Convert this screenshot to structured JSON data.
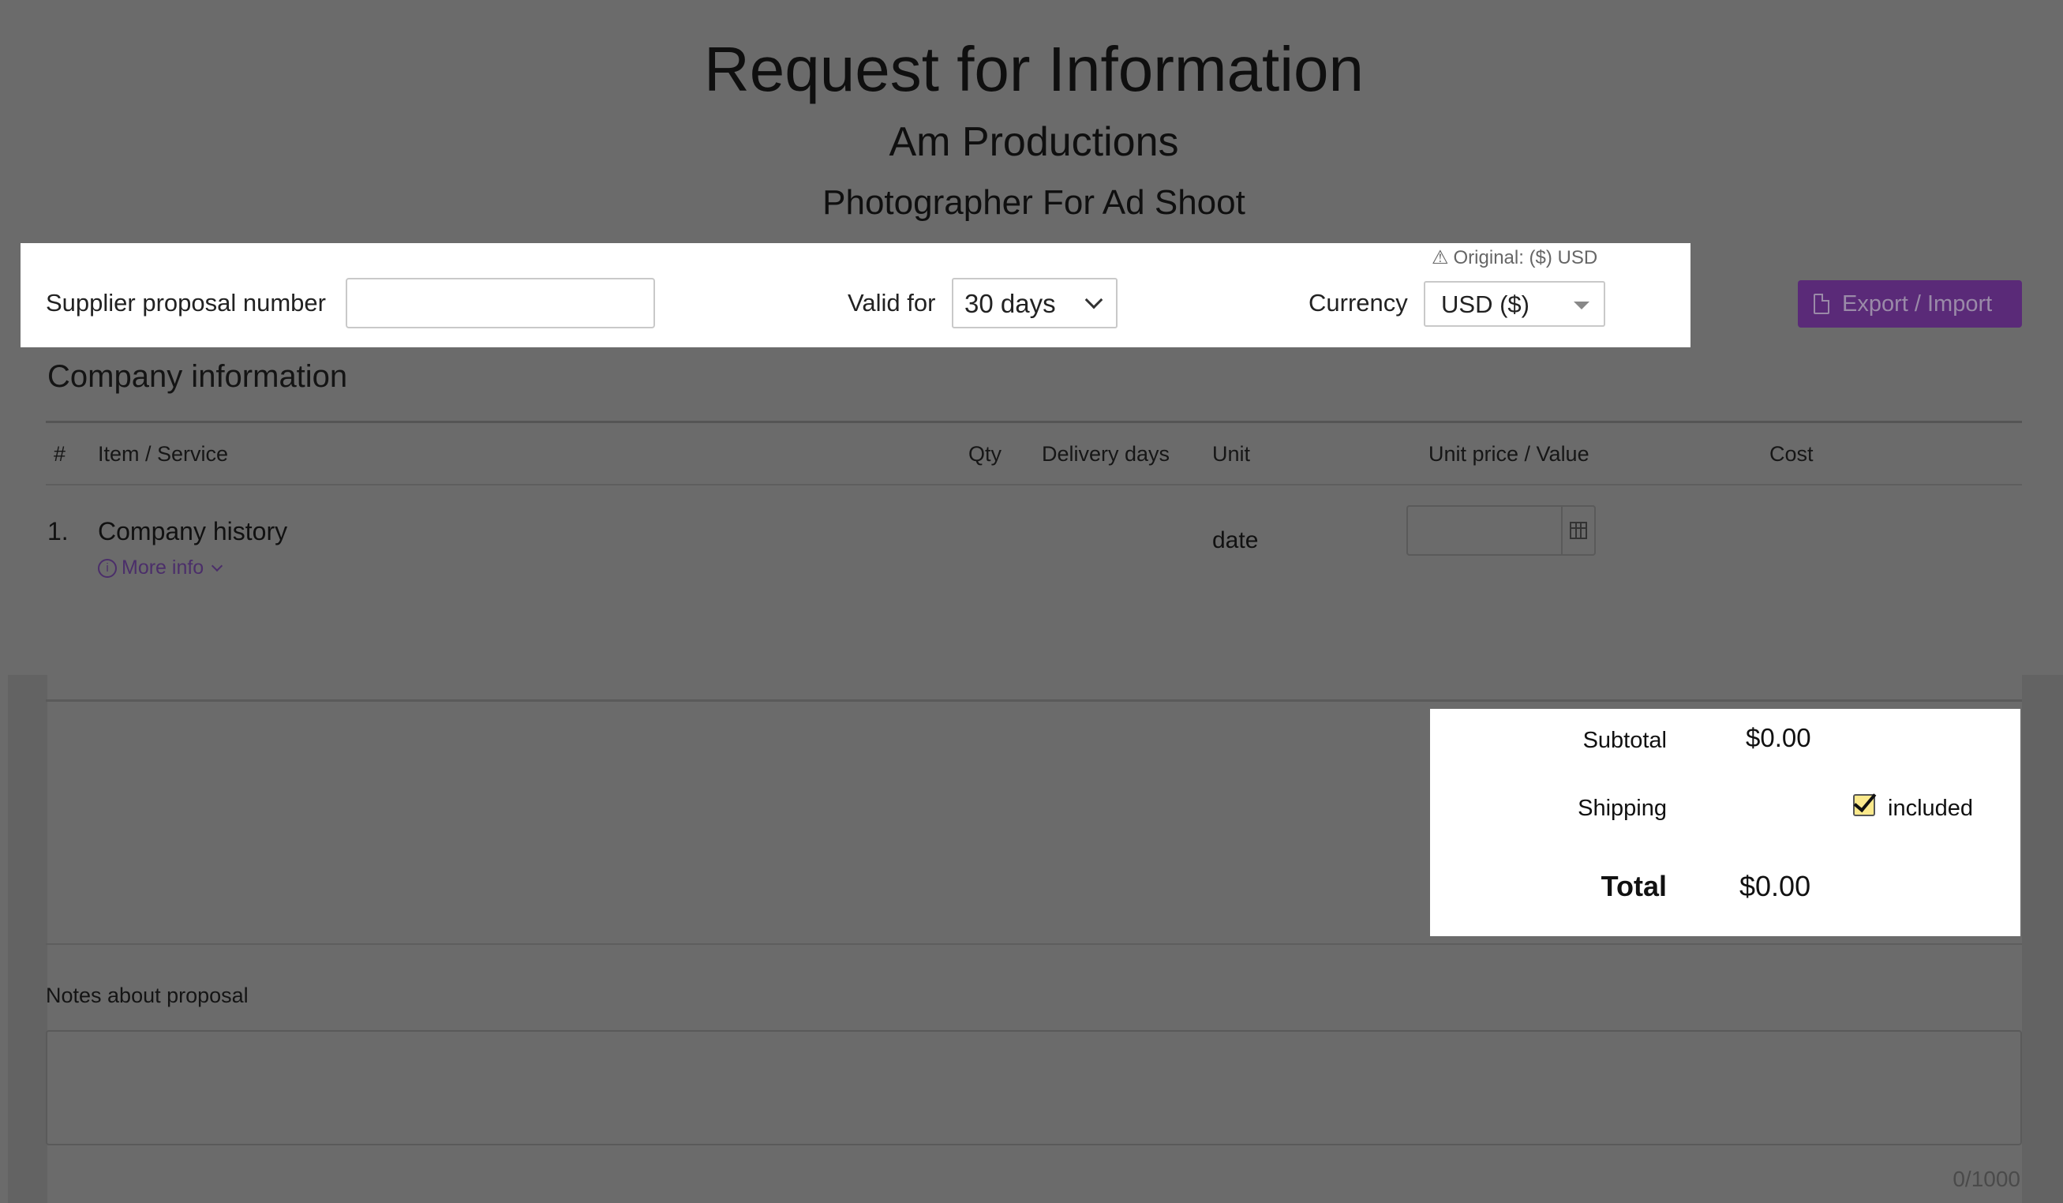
{
  "header": {
    "title": "Request for Information",
    "company": "Am Productions",
    "project": "Photographer For Ad Shoot"
  },
  "proposal": {
    "supplier_label": "Supplier proposal number",
    "supplier_value": "",
    "valid_label": "Valid for",
    "valid_value": "30 days",
    "currency_label": "Currency",
    "currency_value": "USD ($)",
    "original_note": "Original: ($) USD"
  },
  "export_button": "Export / Import",
  "section": {
    "title": "Company information",
    "columns": [
      "#",
      "Item / Service",
      "Qty",
      "Delivery days",
      "Unit",
      "Unit price / Value",
      "Cost"
    ],
    "rows": [
      {
        "num": "1.",
        "item": "Company history",
        "more_info": "More info",
        "unit": "date",
        "value": ""
      }
    ]
  },
  "totals": {
    "subtotal_label": "Subtotal",
    "subtotal_value": "$0.00",
    "shipping_label": "Shipping",
    "shipping_included": true,
    "shipping_included_label": "included",
    "total_label": "Total",
    "total_value": "$0.00"
  },
  "notes": {
    "label": "Notes about proposal",
    "value": "",
    "counter": "0/1000"
  },
  "colors": {
    "overlay_bg": "#6b6b6b",
    "brand_purple": "#5a2a78",
    "checkbox_fill": "#fbe98b"
  }
}
